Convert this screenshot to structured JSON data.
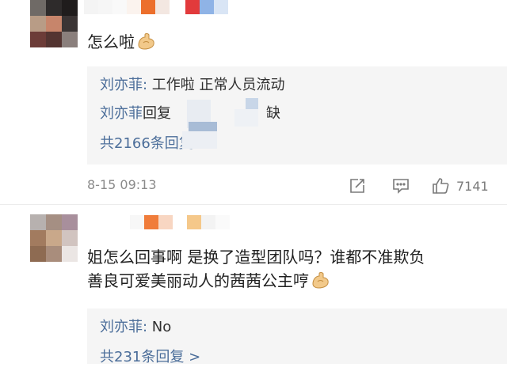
{
  "comments": [
    {
      "text": "怎么啦",
      "replies": {
        "line1_name": "刘亦菲:",
        "line1_text": " 工作啦 正常人员流动",
        "line2_name": "刘亦菲",
        "line2_text_a": "回复",
        "line2_text_b": "缺",
        "total": "共2166条回复 >"
      },
      "timestamp": "8-15 09:13",
      "like_count": "7141"
    },
    {
      "text_line1": "姐怎么回事啊 是换了造型团队吗？谁都不准欺负",
      "text_line2": "善良可爱美丽动人的茜茜公主哼",
      "replies": {
        "line1_name": "刘亦菲:",
        "line1_text": " No",
        "total": "共231条回复 >"
      }
    }
  ],
  "icons": [
    "flexed-biceps-emoji",
    "share-icon",
    "comment-icon",
    "thumbs-up-icon"
  ],
  "colors": {
    "link": "#4c6e9a",
    "reply_bg": "#f5f5f5",
    "meta": "#8a8a8a"
  }
}
